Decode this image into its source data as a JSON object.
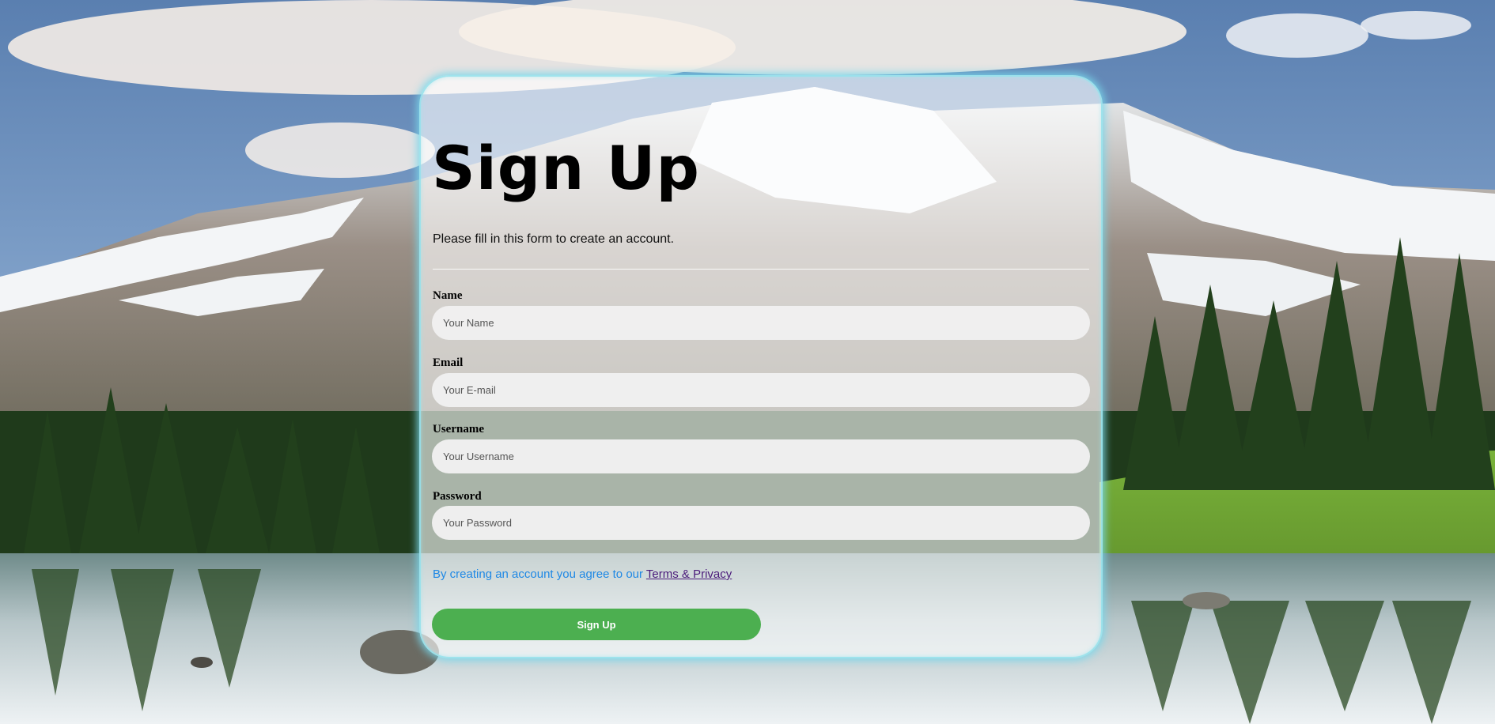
{
  "form": {
    "title": "Sign Up",
    "subtitle": "Please fill in this form to create an account.",
    "fields": [
      {
        "label": "Name",
        "placeholder": "Your Name",
        "value": ""
      },
      {
        "label": "Email",
        "placeholder": "Your E-mail",
        "value": ""
      },
      {
        "label": "Username",
        "placeholder": "Your Username",
        "value": ""
      },
      {
        "label": "Password",
        "placeholder": "Your Password",
        "value": ""
      }
    ],
    "terms_text": "By creating an account you agree to our ",
    "terms_link": "Terms & Privacy",
    "submit_label": "Sign Up"
  },
  "colors": {
    "accent": "#4caf50",
    "terms_text": "#1e88e5",
    "terms_link": "#4a1a7a",
    "card_glow": "#78d7eb"
  },
  "background": {
    "scene": "mountain-lake-landscape"
  }
}
